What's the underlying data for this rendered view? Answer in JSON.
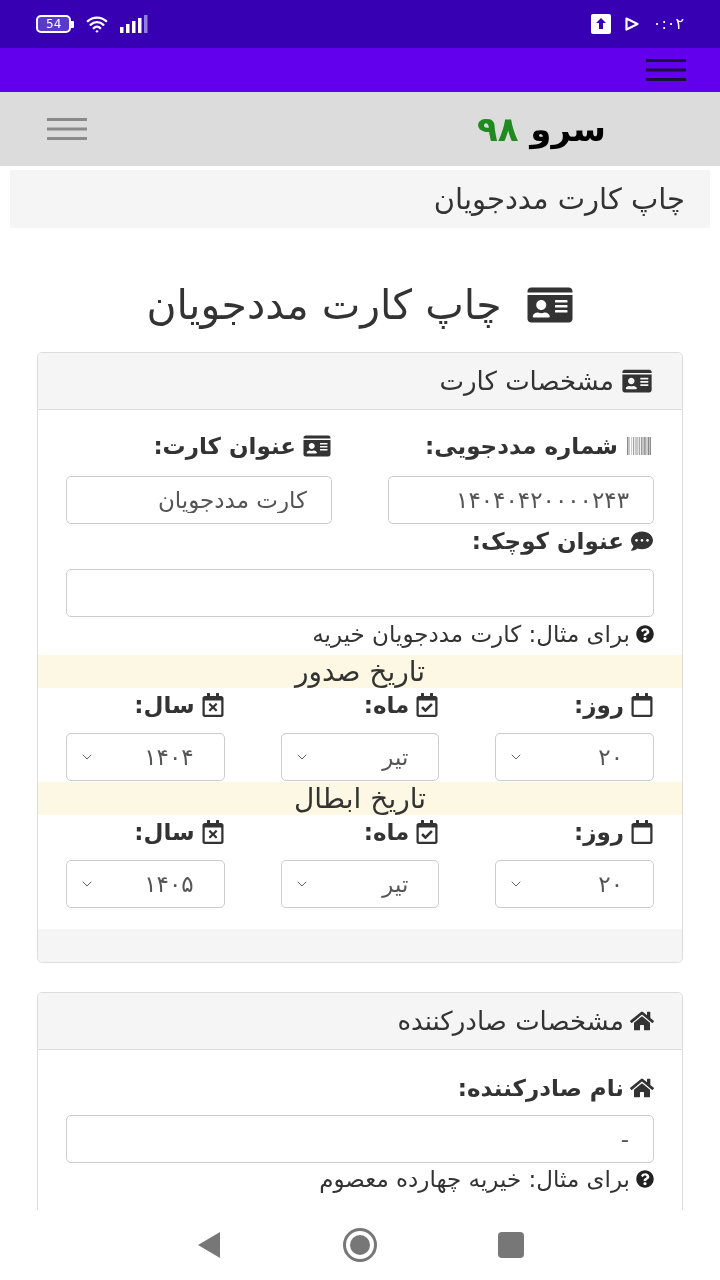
{
  "status_bar": {
    "battery": "54",
    "time": "۰:۰۲"
  },
  "site_header": {
    "logo": {
      "name": "سرو",
      "number": "۹۸"
    }
  },
  "breadcrumb": "چاپ کارت مددجویان",
  "page_title": "چاپ کارت مددجویان",
  "card_section": {
    "title": "مشخصات کارت",
    "client_number": {
      "label": "شماره مددجویی:",
      "value": "۱۴۰۴۰۴۲۰۰۰۰۲۴۳"
    },
    "card_title": {
      "label": "عنوان کارت:",
      "value": "کارت مددجویان"
    },
    "subtitle": {
      "label": "عنوان کوچک:",
      "hint": "برای مثال: کارت مددجویان خیریه"
    },
    "dates": [
      {
        "heading": "تاریخ صدور",
        "fields": [
          {
            "label": "روز:",
            "value": "۲۰"
          },
          {
            "label": "ماه:",
            "value": "تیر"
          },
          {
            "label": "سال:",
            "value": "۱۴۰۴"
          }
        ]
      },
      {
        "heading": "تاریخ ابطال",
        "fields": [
          {
            "label": "روز:",
            "value": "۲۰"
          },
          {
            "label": "ماه:",
            "value": "تیر"
          },
          {
            "label": "سال:",
            "value": "۱۴۰۵"
          }
        ]
      }
    ]
  },
  "issuer_section": {
    "title": "مشخصات صادرکننده",
    "name": {
      "label": "نام صادرکننده:",
      "value": "-",
      "hint": "برای مثال: خیریه چهارده معصوم"
    }
  }
}
